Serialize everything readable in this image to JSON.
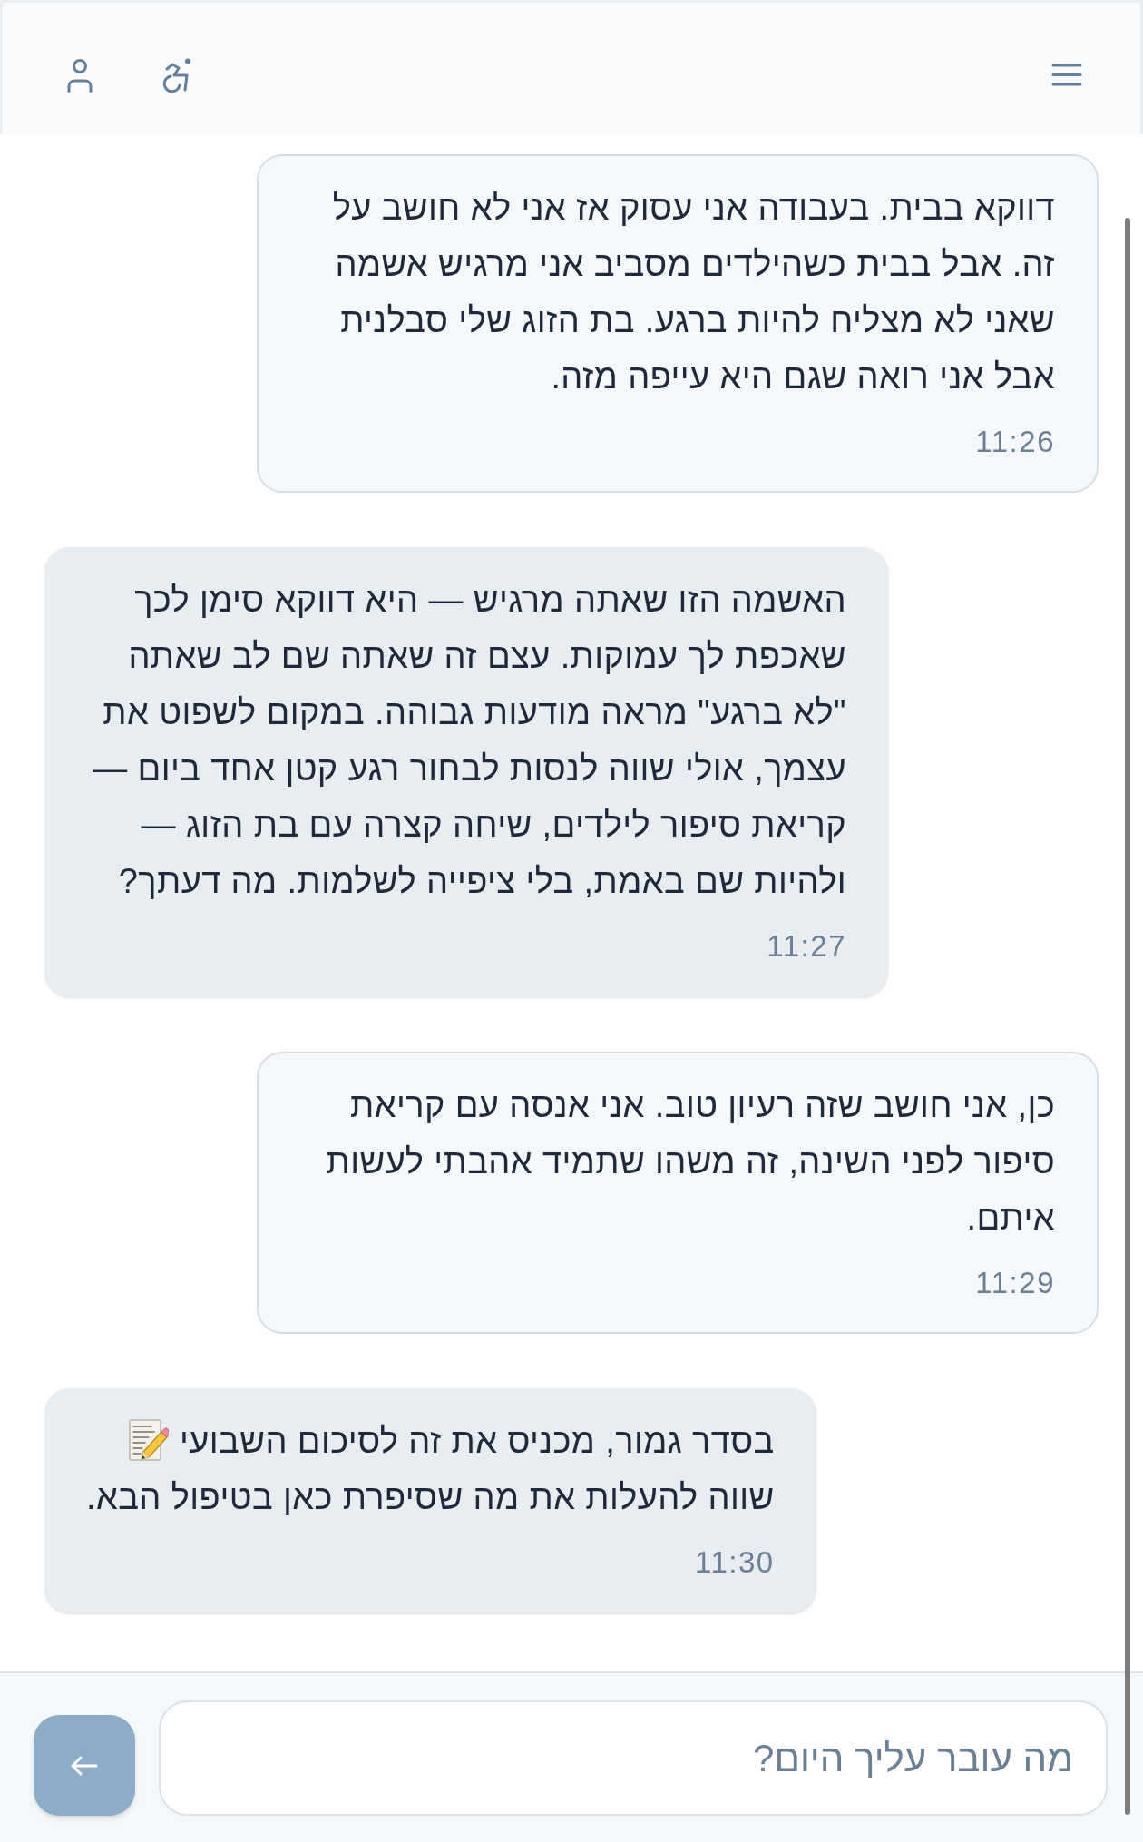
{
  "messages": [
    {
      "kind": "outgoing",
      "lines": [
        {
          "text": "דווקא בבית. בעבודה אני עסוק אז אני לא חושב על זה. אבל בבית כשהילדים מסביב אני מרגיש אשמה שאני לא מצליח להיות ברגע. בת הזוג שלי סבלנית אבל אני רואה שגם היא עייפה מזה.",
          "emoji": false
        }
      ],
      "time": "11:26"
    },
    {
      "kind": "incoming",
      "lines": [
        {
          "text": "האשמה הזו שאתה מרגיש — היא דווקא סימן לכך שאכפת לך עמוקות. עצם זה שאתה שם לב שאתה \"לא ברגע\" מראה מודעות גבוהה. במקום לשפוט את עצמך, אולי שווה לנסות לבחור רגע קטן אחד ביום — קריאת סיפור לילדים, שיחה קצרה עם בת הזוג — ולהיות שם באמת, בלי ציפייה לשלמות. מה דעתך?",
          "emoji": false
        }
      ],
      "time": "11:27"
    },
    {
      "kind": "outgoing",
      "lines": [
        {
          "text": "כן, אני חושב שזה רעיון טוב. אני אנסה עם קריאת סיפור לפני השינה, זה משהו שתמיד אהבתי לעשות איתם.",
          "emoji": false
        }
      ],
      "time": "11:29"
    },
    {
      "kind": "incoming",
      "lines": [
        {
          "text": "בסדר גמור, מכניס את זה לסיכום השבועי",
          "emoji": true
        },
        {
          "text": "שווה להעלות את מה שסיפרת כאן בטיפול הבא.",
          "emoji": false
        }
      ],
      "time": "11:30"
    }
  ],
  "composer": {
    "placeholder": "מה עובר עליך היום?"
  }
}
